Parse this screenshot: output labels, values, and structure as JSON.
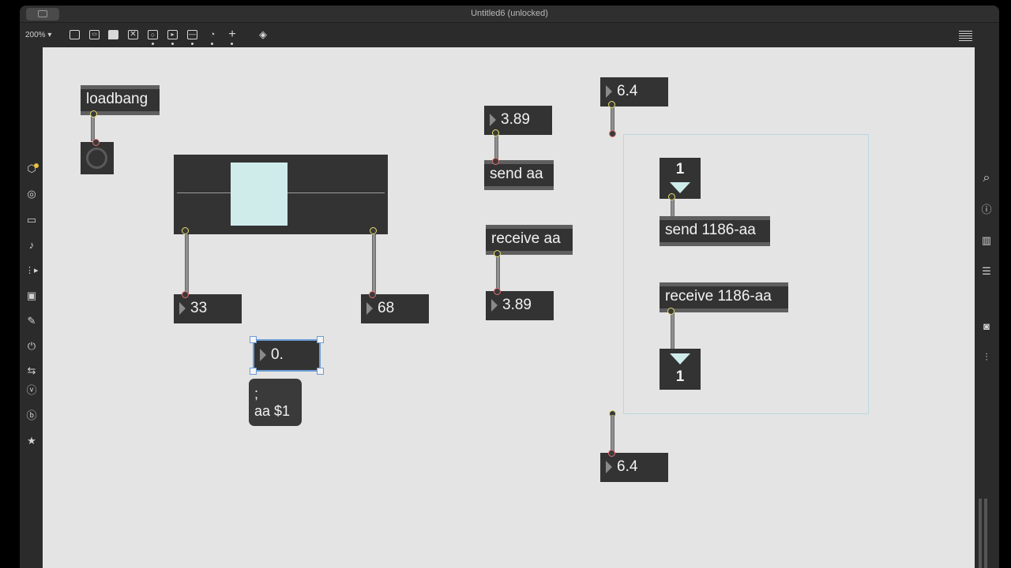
{
  "window": {
    "title": "Untitled6 (unlocked)"
  },
  "toolbar": {
    "zoom_label": "200% ▾",
    "buttons": [
      "new-object-icon",
      "new-message-icon",
      "comment-icon",
      "toggle-icon",
      "bang-icon",
      "playbar-icon",
      "slider-icon",
      "dial-icon",
      "add-icon",
      "paint-bucket-icon"
    ],
    "grid_icon": "grid-icon"
  },
  "left_sidebar": {
    "icons": [
      "package-icon",
      "target-icon",
      "window-icon",
      "music-note-icon",
      "sequence-icon",
      "image-icon",
      "paperclip-icon",
      "plug-icon",
      "loop-icon",
      "v-badge-icon",
      "b-badge-icon",
      "star-icon"
    ],
    "glyphs": [
      "⬡",
      "◎",
      "▭",
      "♪",
      "⋮▸",
      "▣",
      "✎",
      "⏻",
      "⇆",
      "ⓥ",
      "ⓑ",
      "★"
    ]
  },
  "right_sidebar": {
    "icons": [
      "search-icon",
      "info-icon",
      "book-icon",
      "list-icon",
      "camera-icon",
      "mixer-icon"
    ],
    "glyphs": [
      "⌕",
      "ⓘ",
      "▥",
      "☰",
      "◙",
      "⫶"
    ]
  },
  "patch": {
    "loadbang": "loadbang",
    "num_33": "33",
    "num_68": "68",
    "num_zero": "0.",
    "msg_semicolon": ";",
    "msg_aa": "aa $1",
    "num_389_top": "3.89",
    "send_aa": "send aa",
    "receive_aa": "receive aa",
    "num_389_bottom": "3.89",
    "num_64_top": "6.4",
    "tab_top_value": "1",
    "send_1186": "send 1186-aa",
    "receive_1186": "receive 1186-aa",
    "tab_bottom_value": "1",
    "num_64_bottom": "6.4"
  },
  "colors": {
    "canvas": "#e4e4e4",
    "object_body": "#333333",
    "slider_handle": "#cfeceb",
    "selection": "#6c9cd6",
    "inlet_yellow": "#e6de6a",
    "outlet_red": "#e46f6f"
  }
}
